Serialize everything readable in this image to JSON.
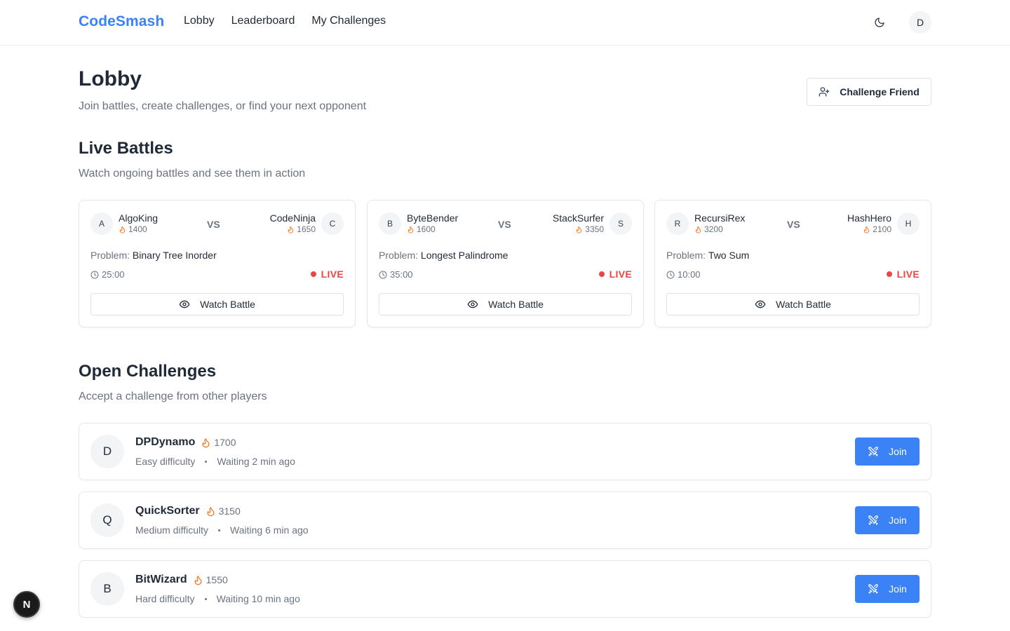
{
  "header": {
    "brand": "CodeSmash",
    "nav": [
      "Lobby",
      "Leaderboard",
      "My Challenges"
    ],
    "user_initial": "D"
  },
  "page": {
    "title": "Lobby",
    "subtitle": "Join battles, create challenges, or find your next opponent",
    "challenge_friend_label": "Challenge Friend"
  },
  "live": {
    "title": "Live Battles",
    "subtitle": "Watch ongoing battles and see them in action",
    "vs_label": "VS",
    "problem_prefix": "Problem:",
    "live_label": "LIVE",
    "watch_label": "Watch Battle",
    "battles": [
      {
        "p1": {
          "initial": "A",
          "name": "AlgoKing",
          "rating": "1400"
        },
        "p2": {
          "initial": "C",
          "name": "CodeNinja",
          "rating": "1650"
        },
        "problem": "Binary Tree Inorder",
        "time": "25:00"
      },
      {
        "p1": {
          "initial": "B",
          "name": "ByteBender",
          "rating": "1600"
        },
        "p2": {
          "initial": "S",
          "name": "StackSurfer",
          "rating": "3350"
        },
        "problem": "Longest Palindrome",
        "time": "35:00"
      },
      {
        "p1": {
          "initial": "R",
          "name": "RecursiRex",
          "rating": "3200"
        },
        "p2": {
          "initial": "H",
          "name": "HashHero",
          "rating": "2100"
        },
        "problem": "Two Sum",
        "time": "10:00"
      }
    ]
  },
  "open": {
    "title": "Open Challenges",
    "subtitle": "Accept a challenge from other players",
    "join_label": "Join",
    "challenges": [
      {
        "initial": "D",
        "name": "DPDynamo",
        "rating": "1700",
        "difficulty": "Easy difficulty",
        "waiting": "Waiting 2 min ago"
      },
      {
        "initial": "Q",
        "name": "QuickSorter",
        "rating": "3150",
        "difficulty": "Medium difficulty",
        "waiting": "Waiting 6 min ago"
      },
      {
        "initial": "B",
        "name": "BitWizard",
        "rating": "1550",
        "difficulty": "Hard difficulty",
        "waiting": "Waiting 10 min ago"
      }
    ]
  },
  "dev_badge": "N",
  "colors": {
    "accent": "#3b82f6",
    "live": "#ef4444",
    "flame": "#f97316"
  }
}
